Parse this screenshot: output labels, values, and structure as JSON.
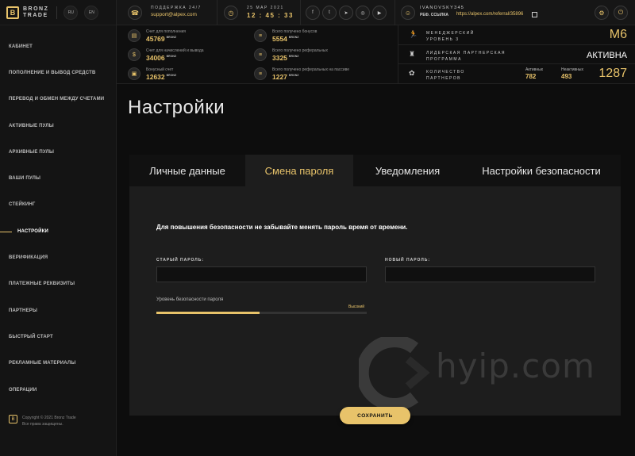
{
  "brand": {
    "name_line1": "BRONZ",
    "name_line2": "TRADE",
    "logo_letter": "B"
  },
  "languages": [
    "RU",
    "EN"
  ],
  "sidebar": {
    "items": [
      {
        "label": "КАБИНЕТ"
      },
      {
        "label": "ПОПОЛНЕНИЕ И ВЫВОД СРЕДСТВ"
      },
      {
        "label": "ПЕРЕВОД И ОБМЕН МЕЖДУ СЧЕТАМИ"
      },
      {
        "label": "АКТИВНЫЕ ПУЛЫ"
      },
      {
        "label": "АРХИВНЫЕ ПУЛЫ"
      },
      {
        "label": "ВАШИ ПУЛЫ"
      },
      {
        "label": "СТЕЙКИНГ"
      },
      {
        "label": "НАСТРОЙКИ"
      },
      {
        "label": "ВЕРИФИКАЦИЯ"
      },
      {
        "label": "ПЛАТЕЖНЫЕ РЕКВИЗИТЫ"
      },
      {
        "label": "ПАРТНЕРЫ"
      },
      {
        "label": "БЫСТРЫЙ СТАРТ"
      },
      {
        "label": "РЕКЛАМНЫЕ МАТЕРИАЛЫ"
      },
      {
        "label": "ОПЕРАЦИИ"
      }
    ],
    "active_index": 7,
    "copyright_line1": "Copyright © 2021 Bronz Trade",
    "copyright_line2": "Все права защищены."
  },
  "header": {
    "support_label": "ПОДДЕРЖКА 24/7",
    "support_email": "support@alpex.com",
    "date": "25 МАР 2021",
    "time": "12 : 45 : 33",
    "social_icons": [
      "facebook-icon",
      "twitter-icon",
      "telegram-icon",
      "instagram-icon",
      "youtube-icon"
    ],
    "social_glyphs": [
      "f",
      "t",
      "➤",
      "◎",
      "▶"
    ],
    "username": "IVANOVSKY345",
    "ref_label": "РЕФ. ССЫЛКА",
    "ref_link": "https://alpex.com/referral/35896"
  },
  "stats": {
    "left": [
      {
        "label": "Счет для пополнения",
        "value": "45769",
        "unit": "BRONZ",
        "icon": "wallet-icon",
        "glyph": "▤"
      },
      {
        "label": "Счет для начислений и вывода",
        "value": "34006",
        "unit": "BRONZ",
        "icon": "coin-icon",
        "glyph": "$"
      },
      {
        "label": "Бонусный счет",
        "value": "12632",
        "unit": "BRONZ",
        "icon": "bonus-icon",
        "glyph": "▣"
      }
    ],
    "right": [
      {
        "label": "Всего получено бонусов",
        "value": "5554",
        "unit": "BRONZ",
        "icon": "stack-icon",
        "glyph": "≡"
      },
      {
        "label": "Всего получено реферальных",
        "value": "3325",
        "unit": "BRONZ",
        "icon": "stack-icon",
        "glyph": "≡"
      },
      {
        "label": "Всего получено реферальных на пассиве",
        "value": "1227",
        "unit": "BRONZ",
        "icon": "stack-icon",
        "glyph": "≡"
      }
    ],
    "rank": {
      "label_line1": "МЕНЕДЖЕРСКИЙ",
      "label_line2": "УРОВЕНЬ 3",
      "value": "M6"
    },
    "leader": {
      "label_line1": "ЛИДЕРСКАЯ ПАРТНЕРСКАЯ",
      "label_line2": "ПРОГРАММА",
      "value": "АКТИВНА"
    },
    "partners": {
      "label_line1": "КОЛИЧЕСТВО",
      "label_line2": "ПАРТНЕРОВ",
      "active_label": "Активных",
      "active_value": "782",
      "inactive_label": "Неактивных",
      "inactive_value": "493",
      "total": "1287"
    }
  },
  "main": {
    "title": "Настройки",
    "tabs": [
      {
        "label": "Личные данные"
      },
      {
        "label": "Смена пароля"
      },
      {
        "label": "Уведомления"
      },
      {
        "label": "Настройки безопасности"
      }
    ],
    "active_tab": 1,
    "hint": "Для повышения безопасности не забывайте менять пароль время от  времени.",
    "old_password_label": "СТАРЫЙ ПАРОЛЬ:",
    "new_password_label": "НОВЫЙ ПАРОЛЬ:",
    "old_password_value": "",
    "new_password_value": "",
    "security_label": "Уровень безопасности пароля",
    "security_level": "Высокий",
    "security_fraction": 0.49,
    "save_label": "СОХРАНИТЬ",
    "watermark_text": "hyip.com"
  },
  "colors": {
    "accent": "#e8c36a",
    "background": "#0d0d0d",
    "panel": "#1d1d1d"
  }
}
